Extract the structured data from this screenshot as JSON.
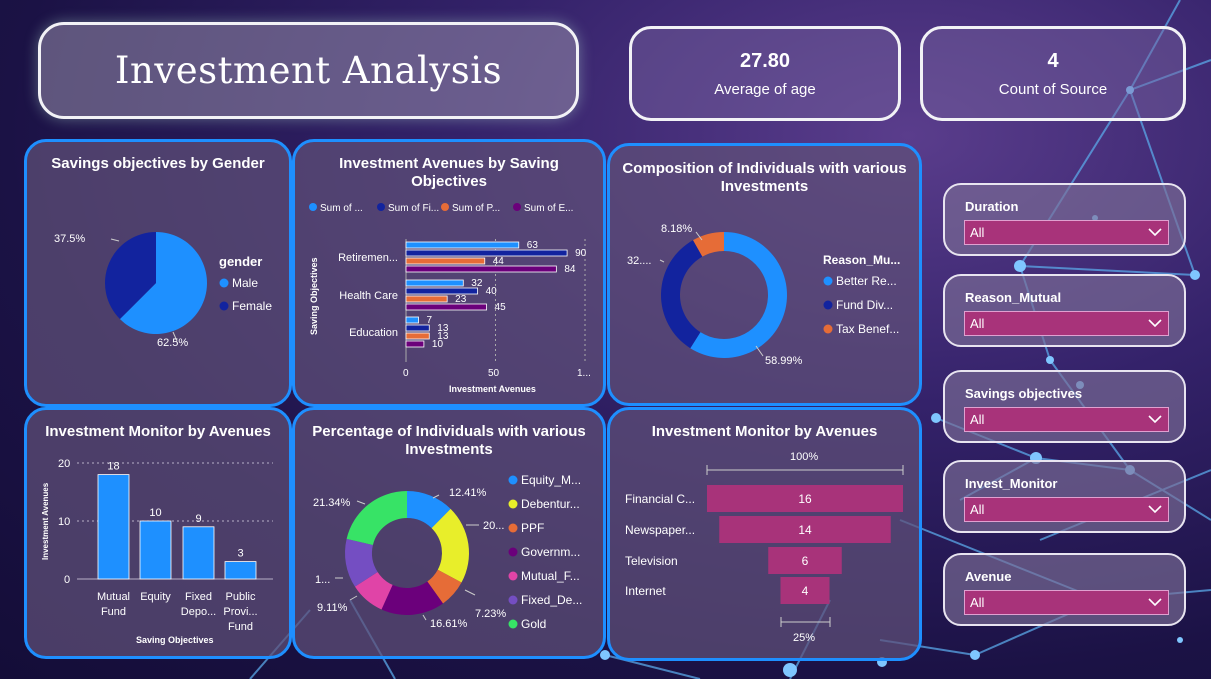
{
  "header": {
    "title": "Investment Analysis"
  },
  "kpis": [
    {
      "value": "27.80",
      "label": "Average of age"
    },
    {
      "value": "4",
      "label": "Count of Source"
    }
  ],
  "colors": {
    "panel_border": "#1e8fff",
    "male": "#1e90ff",
    "female": "#12239e",
    "orange": "#e66c37",
    "purple": "#6b007b",
    "magenta": "#e044a7",
    "violet": "#744ec2",
    "yellow": "#e8ee2a",
    "green": "#37e366",
    "funnel": "#a8337a"
  },
  "charts": {
    "gender": {
      "title": "Savings objectives by Gender",
      "legend_title": "gender",
      "legend": [
        "Male",
        "Female"
      ],
      "labels": {
        "male": "62.5%",
        "female": "37.5%"
      }
    },
    "avenues_saving": {
      "title_line1": "Investment Avenues by Saving",
      "title_line2": "Objectives",
      "legend": [
        "Sum of ...",
        "Sum of Fi...",
        "Sum of P...",
        "Sum of E..."
      ],
      "categories": [
        "Retiremen...",
        "Health Care",
        "Education"
      ],
      "ylabel": "Saving Objectives",
      "xlabel": "Investment Avenues",
      "ticks": [
        "0",
        "50",
        "1..."
      ]
    },
    "composition": {
      "title_line1": "Composition of Individuals with various",
      "title_line2": "Investments",
      "legend_title": "Reason_Mu...",
      "legend": [
        "Better Re...",
        "Fund Div...",
        "Tax Benef..."
      ],
      "labels": {
        "a": "58.99%",
        "b": "32....",
        "c": "8.18%"
      }
    },
    "monitor_bar": {
      "title": "Investment Monitor by Avenues",
      "ylabel": "Investment Avenues",
      "xlabel": "Saving Objectives",
      "ticks": [
        "20",
        "10",
        "0"
      ],
      "categories": [
        [
          "Mutual",
          "Fund"
        ],
        [
          "Equity"
        ],
        [
          "Fixed",
          "Depo..."
        ],
        [
          "Public",
          "Provi...",
          "Fund"
        ]
      ]
    },
    "percentage": {
      "title_line1": "Percentage of Individuals with various",
      "title_line2": "Investments",
      "legend": [
        "Equity_M...",
        "Debentur...",
        "PPF",
        "Governm...",
        "Mutual_F...",
        "Fixed_De...",
        "Gold"
      ],
      "labels": [
        "12.41%",
        "20...",
        "7.23%",
        "16.61%",
        "9.11%",
        "1...",
        "21.34%"
      ]
    },
    "funnel": {
      "title": "Investment Monitor by Avenues",
      "top_label": "100%",
      "bottom_label": "25%",
      "categories": [
        "Financial C...",
        "Newspaper...",
        "Television",
        "Internet"
      ]
    }
  },
  "chart_data": [
    {
      "type": "pie",
      "title": "Savings objectives by Gender",
      "categories": [
        "Male",
        "Female"
      ],
      "values": [
        62.5,
        37.5
      ]
    },
    {
      "type": "bar",
      "title": "Investment Avenues by Saving Objectives",
      "categories": [
        "Retiremen...",
        "Health Care",
        "Education"
      ],
      "series": [
        {
          "name": "Sum of ...",
          "values": [
            63,
            32,
            7
          ]
        },
        {
          "name": "Sum of Fi...",
          "values": [
            90,
            40,
            13
          ]
        },
        {
          "name": "Sum of P...",
          "values": [
            44,
            23,
            13
          ]
        },
        {
          "name": "Sum of E...",
          "values": [
            84,
            45,
            10
          ]
        }
      ],
      "xlabel": "Investment Avenues",
      "ylabel": "Saving Objectives",
      "xlim": [
        0,
        100
      ]
    },
    {
      "type": "pie",
      "title": "Composition of Individuals with various Investments",
      "categories": [
        "Better Re...",
        "Fund Div...",
        "Tax Benef..."
      ],
      "values": [
        58.99,
        32.83,
        8.18
      ]
    },
    {
      "type": "bar",
      "title": "Investment Monitor by Avenues",
      "categories": [
        "Mutual Fund",
        "Equity",
        "Fixed Depo...",
        "Public Provi... Fund"
      ],
      "values": [
        18,
        10,
        9,
        3
      ],
      "xlabel": "Saving Objectives",
      "ylabel": "Investment Avenues",
      "ylim": [
        0,
        20
      ]
    },
    {
      "type": "pie",
      "title": "Percentage of Individuals with various Investments",
      "categories": [
        "Equity_M...",
        "Debentur...",
        "PPF",
        "Governm...",
        "Mutual_F...",
        "Fixed_De...",
        "Gold"
      ],
      "values": [
        12.41,
        20.5,
        7.23,
        16.61,
        9.11,
        12.8,
        21.34
      ]
    },
    {
      "type": "bar",
      "title": "Investment Monitor by Avenues",
      "categories": [
        "Financial C...",
        "Newspaper...",
        "Television",
        "Internet"
      ],
      "values": [
        16,
        14,
        6,
        4
      ]
    }
  ],
  "slicers": [
    {
      "label": "Duration",
      "value": "All"
    },
    {
      "label": "Reason_Mutual",
      "value": "All"
    },
    {
      "label": "Savings objectives",
      "value": "All"
    },
    {
      "label": "Invest_Monitor",
      "value": "All"
    },
    {
      "label": "Avenue",
      "value": "All"
    }
  ]
}
